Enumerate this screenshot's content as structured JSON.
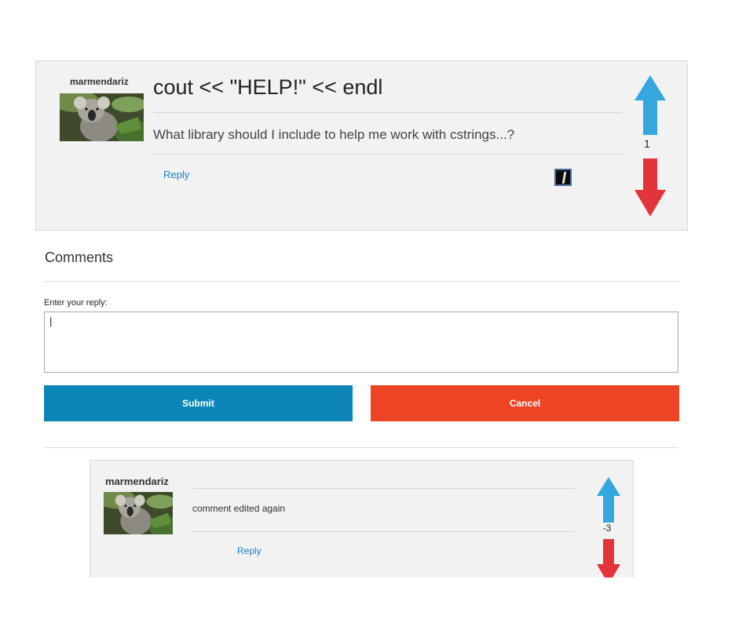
{
  "post": {
    "author": "marmendariz",
    "title": "cout << \"HELP!\" << endl",
    "body": "What library should I include to help me work with cstrings...?",
    "reply_label": "Reply",
    "score": "1"
  },
  "comments_section": {
    "heading": "Comments",
    "reply_label": "Enter your reply:",
    "reply_value": "|",
    "submit_label": "Submit",
    "cancel_label": "Cancel"
  },
  "comment": {
    "author": "marmendariz",
    "body": "comment edited again",
    "reply_label": "Reply",
    "score": "-3"
  },
  "colors": {
    "upvote": "#35a6de",
    "downvote": "#e3343c",
    "submit": "#0c86b9",
    "cancel": "#ed4426",
    "link": "#1b7fc1"
  },
  "icons": {
    "upvote": "arrow-up-icon",
    "downvote": "arrow-down-icon",
    "flag": "flag-icon",
    "avatar": "koala-avatar"
  }
}
